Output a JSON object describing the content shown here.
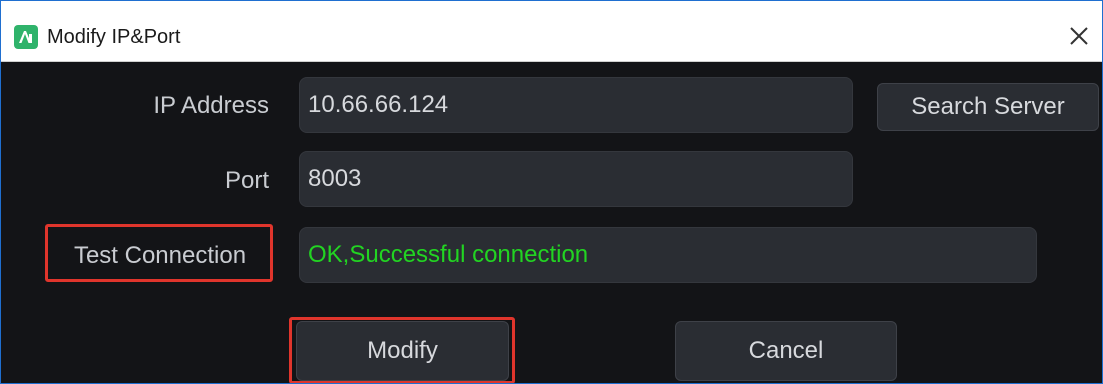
{
  "window": {
    "title": "Modify IP&Port"
  },
  "form": {
    "ip_label": "IP Address",
    "ip_value": "10.66.66.124",
    "port_label": "Port",
    "port_value": "8003",
    "test_label": "Test Connection",
    "test_result": "OK,Successful connection",
    "test_result_color": "#22d422"
  },
  "buttons": {
    "search_server": "Search Server",
    "modify": "Modify",
    "cancel": "Cancel"
  },
  "colors": {
    "accent_highlight": "#e0352c",
    "app_icon": "#2fb36b",
    "dialog_background": "#131417"
  },
  "icons": {
    "app": "app-logo-icon",
    "close": "close-icon"
  }
}
